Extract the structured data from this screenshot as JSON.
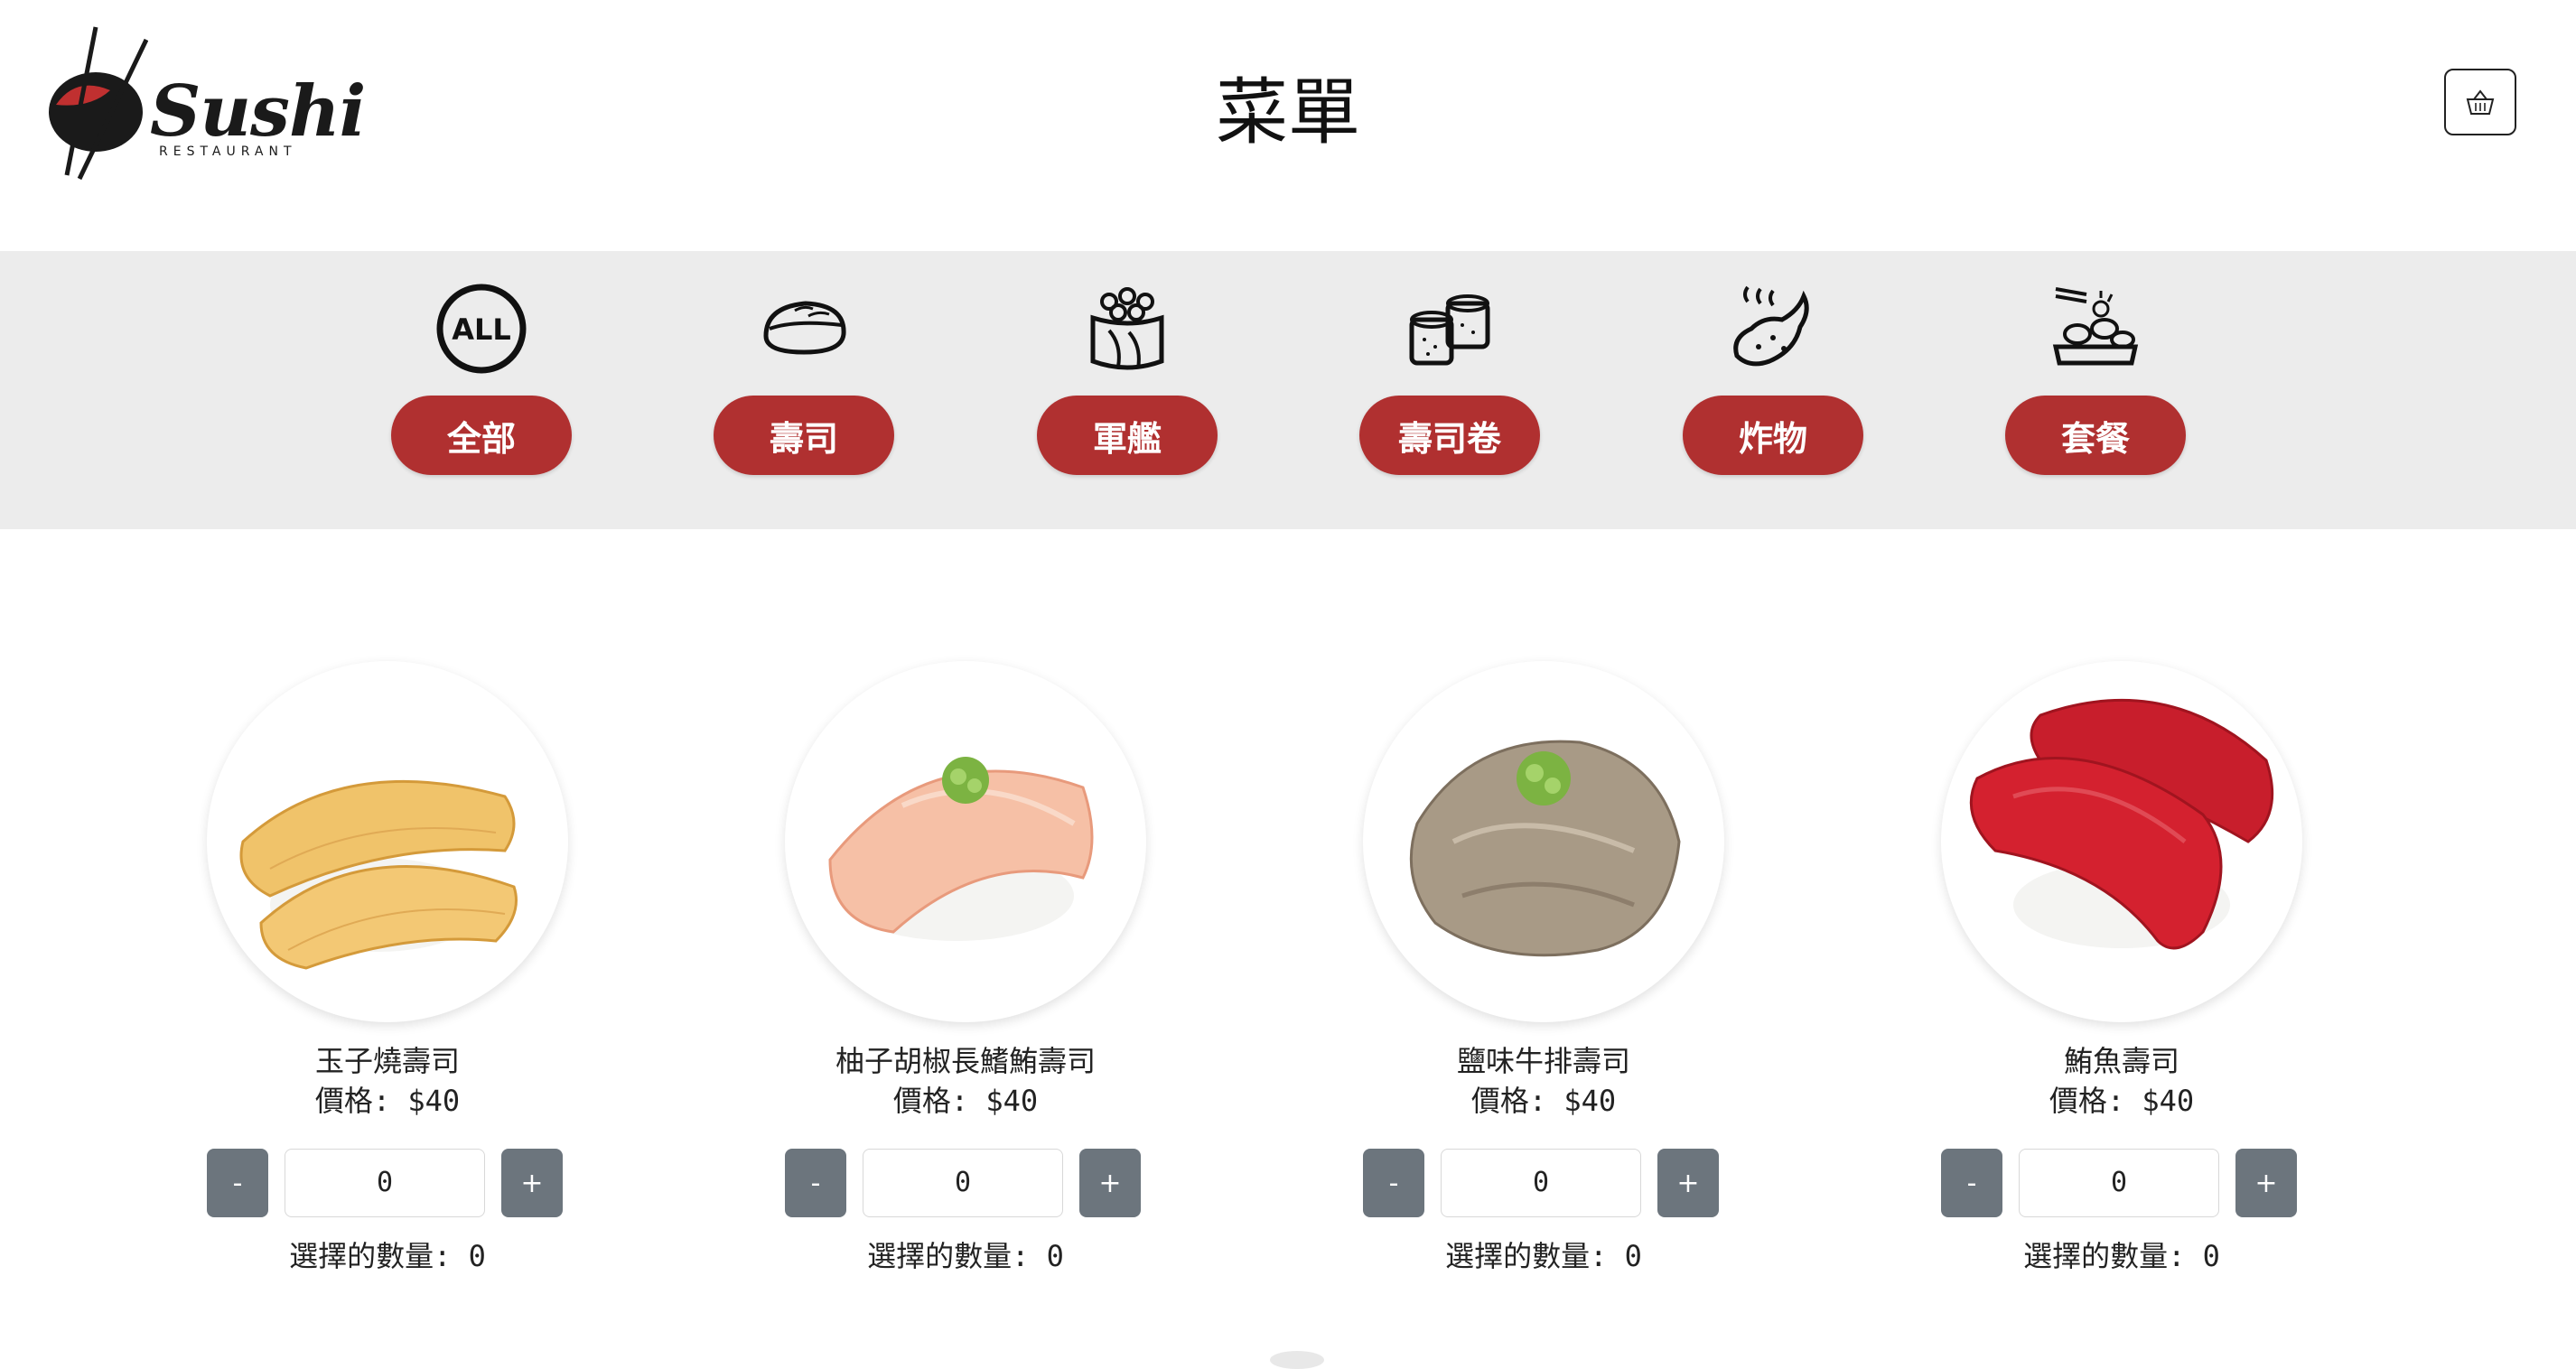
{
  "header": {
    "logo_text": "Sushi",
    "logo_sub": "RESTAURANT",
    "title": "菜單"
  },
  "colors": {
    "accent": "#b03030",
    "band": "#ececec",
    "stepper": "#6c757d"
  },
  "categories": [
    {
      "label": "全部",
      "icon": "all-icon"
    },
    {
      "label": "壽司",
      "icon": "nigiri-icon"
    },
    {
      "label": "軍艦",
      "icon": "gunkan-icon"
    },
    {
      "label": "壽司卷",
      "icon": "maki-roll-icon"
    },
    {
      "label": "炸物",
      "icon": "tempura-icon"
    },
    {
      "label": "套餐",
      "icon": "set-meal-icon"
    }
  ],
  "items": [
    {
      "name": "玉子燒壽司",
      "price": "價格: $40",
      "quantity": "0",
      "selected": "選擇的數量: 0",
      "minus": "-",
      "plus": "+"
    },
    {
      "name": "柚子胡椒長鰭鮪壽司",
      "price": "價格: $40",
      "quantity": "0",
      "selected": "選擇的數量: 0",
      "minus": "-",
      "plus": "+"
    },
    {
      "name": "鹽味牛排壽司",
      "price": "價格: $40",
      "quantity": "0",
      "selected": "選擇的數量: 0",
      "minus": "-",
      "plus": "+"
    },
    {
      "name": "鮪魚壽司",
      "price": "價格: $40",
      "quantity": "0",
      "selected": "選擇的數量: 0",
      "minus": "-",
      "plus": "+"
    }
  ]
}
